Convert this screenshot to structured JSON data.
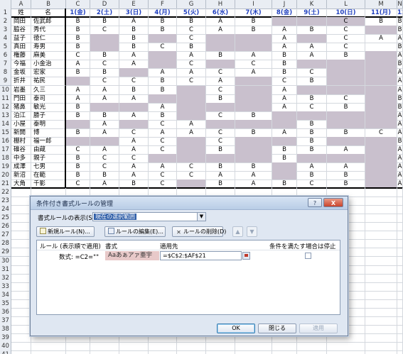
{
  "sheet": {
    "column_letters": [
      "A",
      "B",
      "C",
      "D",
      "E",
      "F",
      "G",
      "H",
      "I",
      "J",
      "K",
      "L",
      "M",
      "N"
    ],
    "header_row": [
      "姓",
      "名",
      "1(金)",
      "2(土)",
      "3(日)",
      "4(月)",
      "5(火)",
      "6(水)",
      "7(木)",
      "8(金)",
      "9(土)",
      "10(日)",
      "11(月)",
      "12("
    ],
    "extra_row_numbers": [
      "22",
      "23",
      "24",
      "25",
      "26",
      "27",
      "28",
      "29",
      "30",
      "31",
      "32",
      "33",
      "34",
      "35",
      "36",
      "37",
      "38",
      "39",
      "40",
      "41"
    ],
    "rows": [
      {
        "n": "2",
        "last": "岡田",
        "first": "佐武郎",
        "v": [
          "B",
          "B",
          "A",
          "B",
          "B",
          "A",
          "B",
          "",
          "",
          "C",
          "B",
          "B"
        ],
        "h": [
          7,
          8,
          9
        ]
      },
      {
        "n": "3",
        "last": "脇谷",
        "first": "秀代",
        "v": [
          "B",
          "C",
          "B",
          "B",
          "C",
          "A",
          "B",
          "A",
          "B",
          "C",
          "",
          "B"
        ],
        "h": [
          10
        ]
      },
      {
        "n": "4",
        "last": "益子",
        "first": "徳仁",
        "v": [
          "B",
          "",
          "B",
          "",
          "C",
          "",
          "",
          "A",
          "",
          "C",
          "A",
          "A"
        ],
        "h": [
          1,
          3,
          5,
          6,
          8
        ]
      },
      {
        "n": "5",
        "last": "真田",
        "first": "寿男",
        "v": [
          "B",
          "",
          "B",
          "C",
          "B",
          "",
          "",
          "A",
          "A",
          "C",
          "",
          "B"
        ],
        "h": [
          1,
          5,
          6
        ]
      },
      {
        "n": "6",
        "last": "権藤",
        "first": "麻美",
        "v": [
          "C",
          "B",
          "A",
          "",
          "A",
          "B",
          "A",
          "B",
          "A",
          "B",
          "",
          "A"
        ],
        "h": [
          3,
          10
        ]
      },
      {
        "n": "7",
        "last": "今福",
        "first": "小金治",
        "v": [
          "A",
          "C",
          "A",
          "",
          "C",
          "",
          "C",
          "B",
          "",
          "",
          "",
          "B"
        ],
        "h": [
          3,
          5,
          8,
          9,
          10
        ]
      },
      {
        "n": "8",
        "last": "金坂",
        "first": "宏家",
        "v": [
          "B",
          "B",
          "",
          "A",
          "A",
          "C",
          "A",
          "B",
          "C",
          "",
          "",
          "A"
        ],
        "h": [
          2,
          9,
          10
        ]
      },
      {
        "n": "9",
        "last": "折井",
        "first": "祐民",
        "v": [
          "",
          "C",
          "C",
          "B",
          "C",
          "A",
          "",
          "C",
          "B",
          "",
          "",
          "A"
        ],
        "h": [
          0,
          6,
          9,
          10
        ]
      },
      {
        "n": "10",
        "last": "岩墨",
        "first": "久三",
        "v": [
          "A",
          "A",
          "B",
          "B",
          "",
          "C",
          "",
          "A",
          "",
          "",
          "",
          "A"
        ],
        "h": [
          4,
          6,
          8,
          9,
          10
        ]
      },
      {
        "n": "11",
        "last": "門田",
        "first": "泰司",
        "v": [
          "A",
          "A",
          "A",
          "",
          "",
          "B",
          "",
          "A",
          "B",
          "C",
          "",
          "B"
        ],
        "h": [
          3,
          4,
          6,
          10
        ]
      },
      {
        "n": "12",
        "last": "猪鼻",
        "first": "敏光",
        "v": [
          "B",
          "",
          "",
          "A",
          "",
          "",
          "",
          "A",
          "C",
          "B",
          "",
          "B"
        ],
        "h": [
          1,
          2,
          4,
          5,
          6,
          10
        ]
      },
      {
        "n": "13",
        "last": "泊江",
        "first": "勝子",
        "v": [
          "B",
          "B",
          "A",
          "B",
          "",
          "C",
          "B",
          "",
          "",
          "",
          "",
          "A"
        ],
        "h": [
          4,
          7,
          8,
          9,
          10
        ]
      },
      {
        "n": "14",
        "last": "小屋",
        "first": "泰明",
        "v": [
          "",
          "A",
          "",
          "C",
          "A",
          "",
          "",
          "",
          "B",
          "",
          "",
          "A"
        ],
        "h": [
          0,
          2,
          5,
          6,
          7,
          9,
          10
        ]
      },
      {
        "n": "15",
        "last": "新開",
        "first": "博",
        "v": [
          "B",
          "A",
          "C",
          "A",
          "A",
          "C",
          "B",
          "A",
          "B",
          "B",
          "C",
          "A"
        ],
        "h": []
      },
      {
        "n": "16",
        "last": "棚村",
        "first": "福一郎",
        "v": [
          "",
          "",
          "A",
          "C",
          "",
          "C",
          "",
          "",
          "B",
          "",
          "",
          "B"
        ],
        "h": [
          0,
          1,
          4,
          6,
          7,
          9,
          10
        ]
      },
      {
        "n": "17",
        "last": "碓谷",
        "first": "由蔵",
        "v": [
          "C",
          "A",
          "A",
          "C",
          "",
          "B",
          "",
          "B",
          "B",
          "A",
          "",
          "A"
        ],
        "h": [
          4,
          6,
          10
        ]
      },
      {
        "n": "18",
        "last": "中多",
        "first": "親子",
        "v": [
          "B",
          "C",
          "C",
          "",
          "",
          "",
          "",
          "B",
          "",
          "",
          "",
          "A"
        ],
        "h": [
          3,
          4,
          5,
          6,
          8,
          9,
          10
        ]
      },
      {
        "n": "19",
        "last": "成澤",
        "first": "七男",
        "v": [
          "B",
          "C",
          "A",
          "A",
          "C",
          "B",
          "B",
          "",
          "A",
          "A",
          "",
          "A"
        ],
        "h": [
          7,
          10
        ]
      },
      {
        "n": "20",
        "last": "新沼",
        "first": "在範",
        "v": [
          "B",
          "B",
          "A",
          "C",
          "C",
          "A",
          "A",
          "",
          "B",
          "B",
          "",
          "A"
        ],
        "h": [
          7,
          10
        ]
      },
      {
        "n": "21",
        "last": "大角",
        "first": "千影",
        "v": [
          "C",
          "A",
          "B",
          "C",
          "",
          "B",
          "A",
          "B",
          "C",
          "B",
          "",
          "A"
        ],
        "h": [
          4,
          10
        ]
      }
    ]
  },
  "dialog": {
    "title": "条件付き書式ルールの管理",
    "help_label": "?",
    "close_label": "X",
    "show_rules_label": "書式ルールの表示(S):",
    "show_rules_value": "現在の選択範囲",
    "new_rule_label": "新規ルール(N)...",
    "edit_rule_label": "ルールの編集(E)...",
    "delete_rule_label": "ルールの削除(D)",
    "col_rule": "ルール (表示順で適用)",
    "col_format": "書式",
    "col_applies": "適用先",
    "col_stop": "条件を満たす場合は停止",
    "rule_condition": "数式: =C2=\"\"",
    "rule_format_preview": "Aaあぁアァ亜宇",
    "rule_applies_to": "=$C$2:$AF$21",
    "ok_label": "OK",
    "close_button_label": "閉じる",
    "apply_label": "適用"
  }
}
